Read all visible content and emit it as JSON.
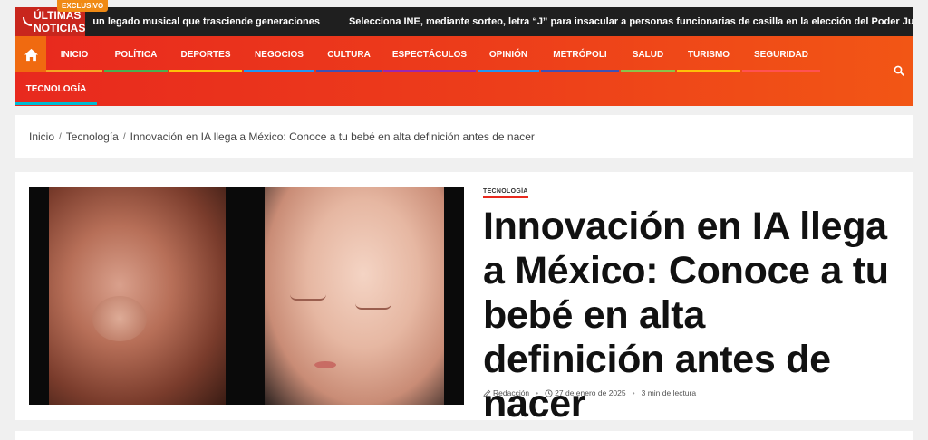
{
  "ticker": {
    "label": "ÚLTIMAS NOTICIAS",
    "badge": "EXCLUSIVO",
    "items": [
      "un legado musical que trasciende generaciones",
      "Selecciona INE, mediante sorteo, letra “J” para insacular a personas funcionarias de casilla en la elección del Poder Judicial"
    ]
  },
  "nav": {
    "home_icon": "home-icon",
    "items": [
      {
        "label": "INICIO",
        "color": "#f5a623"
      },
      {
        "label": "POLÍTICA",
        "color": "#4caf50"
      },
      {
        "label": "DEPORTES",
        "color": "#ffc107"
      },
      {
        "label": "NEGOCIOS",
        "color": "#2196f3"
      },
      {
        "label": "CULTURA",
        "color": "#3f51b5"
      },
      {
        "label": "ESPECTÁCULOS",
        "color": "#9c27b0"
      },
      {
        "label": "OPINIÓN",
        "color": "#2196f3"
      },
      {
        "label": "METRÓPOLI",
        "color": "#3f51b5"
      },
      {
        "label": "SALUD",
        "color": "#8bc34a"
      },
      {
        "label": "TURISMO",
        "color": "#ffc107"
      },
      {
        "label": "SEGURIDAD",
        "color": "#ff5252"
      },
      {
        "label": "TECNOLOGÍA",
        "color": "#00bcd4"
      }
    ],
    "search_icon": "search-icon"
  },
  "breadcrumb": {
    "items": [
      "Inicio",
      "Tecnología",
      "Innovación en IA llega a México: Conoce a tu bebé en alta definición antes de nacer"
    ]
  },
  "article": {
    "category": "TECNOLOGÍA",
    "title": "Innovación en IA llega a México: Conoce a tu bebé en alta definición antes de nacer",
    "author": "Redacción",
    "date": "27 de enero de 2025",
    "read_time": "3 min de lectura"
  },
  "colors": {
    "accent": "#e8291e",
    "ticker_bg": "#1f1f1f",
    "badge": "#f08a14"
  }
}
